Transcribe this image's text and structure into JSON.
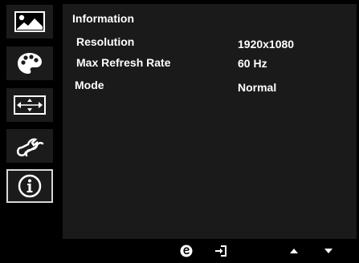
{
  "sidebar": {
    "items": [
      {
        "icon": "picture-icon",
        "selected": false
      },
      {
        "icon": "palette-icon",
        "selected": false
      },
      {
        "icon": "position-icon",
        "selected": false
      },
      {
        "icon": "wrench-icon",
        "selected": false
      },
      {
        "icon": "info-icon",
        "selected": true
      }
    ]
  },
  "panel": {
    "title": "Information",
    "rows": [
      {
        "label": "Resolution",
        "value": "1920x1080"
      },
      {
        "label": "Max Refresh Rate",
        "value": "60 Hz"
      },
      {
        "label": "Mode",
        "value": "Normal"
      }
    ]
  },
  "bottombar": {
    "keys": [
      {
        "icon": "eco-icon"
      },
      {
        "icon": "input-source-icon"
      },
      {
        "icon": "arrow-up-icon"
      },
      {
        "icon": "arrow-down-icon"
      }
    ]
  },
  "colors": {
    "background": "#000000",
    "panel": "#1a1a1a",
    "tile": "#1b1b1b",
    "selected_border": "#d8d8d8",
    "text": "#ffffff"
  }
}
